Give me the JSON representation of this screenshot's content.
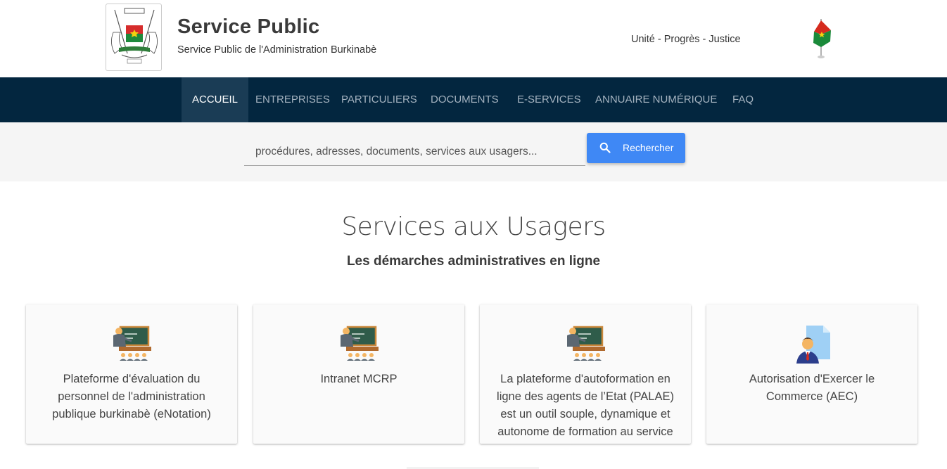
{
  "header": {
    "title": "Service Public",
    "subtitle": "Service Public de l'Administration Burkinabè",
    "motto": "Unité - Progrès - Justice",
    "coat_icon": "coat-of-arms-icon",
    "flag_icon": "burkina-flag-icon"
  },
  "nav": {
    "items": [
      {
        "label": "ACCUEIL",
        "active": true
      },
      {
        "label": "ENTREPRISES"
      },
      {
        "label": "PARTICULIERS"
      },
      {
        "label": "DOCUMENTS"
      },
      {
        "label": "E-SERVICES"
      },
      {
        "label": "ANNUAIRE NUMÉRIQUE"
      },
      {
        "label": "FAQ"
      }
    ],
    "colors": {
      "background": "#03263f",
      "active": "#1a3c55",
      "text": "#a5b3c0"
    }
  },
  "search": {
    "placeholder": "procédures, adresses, documents, services aux usagers...",
    "button_label": "Rechercher",
    "button_icon": "search-icon",
    "button_color": "#3f88f5"
  },
  "section": {
    "title": "Services aux Usagers",
    "subtitle": "Les démarches administratives en ligne"
  },
  "cards": [
    {
      "icon": "teacher-board-icon",
      "text": "Plateforme d'évaluation du personnel de l'administration publique burkinabè (eNotation)"
    },
    {
      "icon": "teacher-board-icon",
      "text": "Intranet MCRP"
    },
    {
      "icon": "teacher-board-icon",
      "text": "La plateforme d'autoformation en ligne des agents de l’Etat (PALAE) est un outil souple, dynamique et autonome de formation au service"
    },
    {
      "icon": "business-person-document-icon",
      "text": "Autorisation d'Exercer le Commerce (AEC)"
    }
  ]
}
